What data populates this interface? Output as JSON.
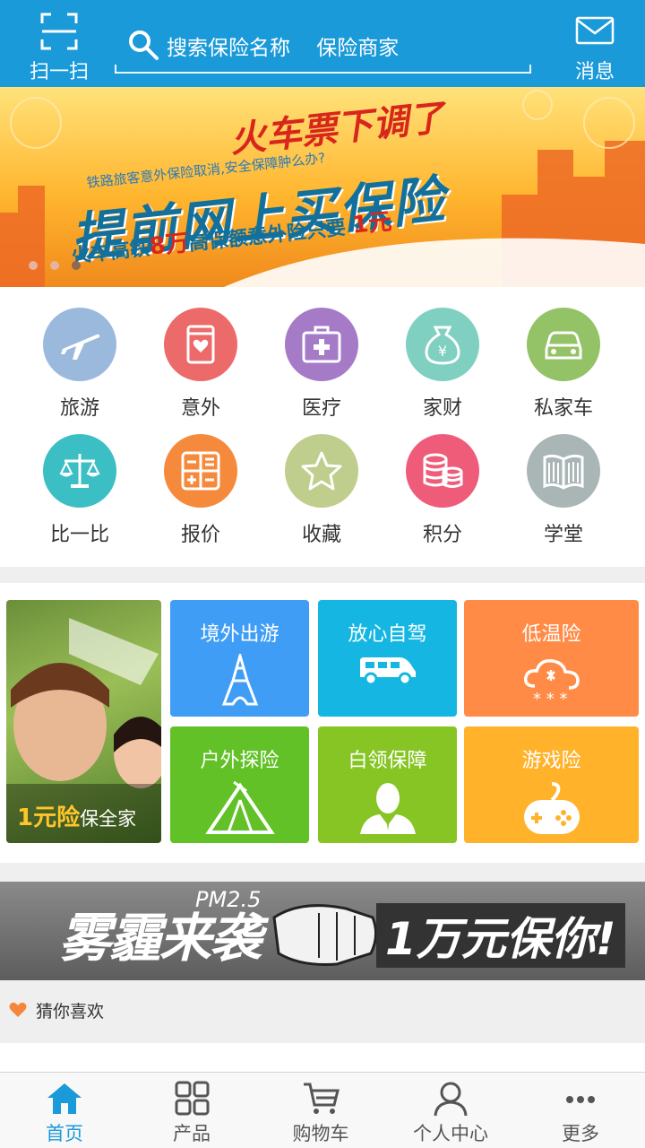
{
  "header": {
    "scan_label": "扫一扫",
    "search_placeholder": "搜索保险名称    保险商家",
    "message_label": "消息"
  },
  "banner": {
    "headline": "火车票下调了",
    "subline": "铁路旅客意外保险取消,安全保障肿么办?",
    "main": "提前网上买保险",
    "bottom_a": "火车高铁",
    "bottom_b": "8万",
    "bottom_c": "高保额意外险只要",
    "price": "1元",
    "slide_count": 3,
    "active_slide": 3
  },
  "categories": [
    {
      "label": "旅游",
      "icon": "plane-icon",
      "color": "#9bb9dd"
    },
    {
      "label": "意外",
      "icon": "bandage-icon",
      "color": "#ec6a6a"
    },
    {
      "label": "医疗",
      "icon": "medical-kit-icon",
      "color": "#a57bc7"
    },
    {
      "label": "家财",
      "icon": "money-bag-icon",
      "color": "#7fd0c0"
    },
    {
      "label": "私家车",
      "icon": "car-icon",
      "color": "#94c266"
    },
    {
      "label": "比一比",
      "icon": "scale-icon",
      "color": "#3bbec4"
    },
    {
      "label": "报价",
      "icon": "calculator-icon",
      "color": "#f58a3c"
    },
    {
      "label": "收藏",
      "icon": "star-icon",
      "color": "#bfcd8d"
    },
    {
      "label": "积分",
      "icon": "coins-icon",
      "color": "#ef5c7a"
    },
    {
      "label": "学堂",
      "icon": "book-icon",
      "color": "#aab6b6"
    }
  ],
  "promo": {
    "photo_caption_a": "1元险",
    "photo_caption_b": "保全家",
    "tiles": [
      {
        "label": "境外出游",
        "icon": "eiffel-tower-icon",
        "color": "#3f9df5"
      },
      {
        "label": "放心自驾",
        "icon": "van-icon",
        "color": "#15b7e2"
      },
      {
        "label": "低温险",
        "icon": "snow-cloud-icon",
        "color": "#ff8b46"
      },
      {
        "label": "户外探险",
        "icon": "tent-icon",
        "color": "#62c126"
      },
      {
        "label": "白领保障",
        "icon": "person-icon",
        "color": "#86c523"
      },
      {
        "label": "游戏险",
        "icon": "gamepad-icon",
        "color": "#ffb22a"
      }
    ]
  },
  "smog_banner": {
    "word1": "雾霾来袭",
    "word2": "PM2.5",
    "word3": "1万元保你!"
  },
  "guess": {
    "label": "猜你喜欢",
    "icon": "heart-icon",
    "color": "#f5863b"
  },
  "nav": [
    {
      "label": "首页",
      "icon": "home-icon",
      "active": true
    },
    {
      "label": "产品",
      "icon": "grid-icon",
      "active": false
    },
    {
      "label": "购物车",
      "icon": "cart-icon",
      "active": false
    },
    {
      "label": "个人中心",
      "icon": "user-icon",
      "active": false
    },
    {
      "label": "更多",
      "icon": "more-icon",
      "active": false
    }
  ],
  "colors": {
    "primary": "#1b9ad9"
  }
}
